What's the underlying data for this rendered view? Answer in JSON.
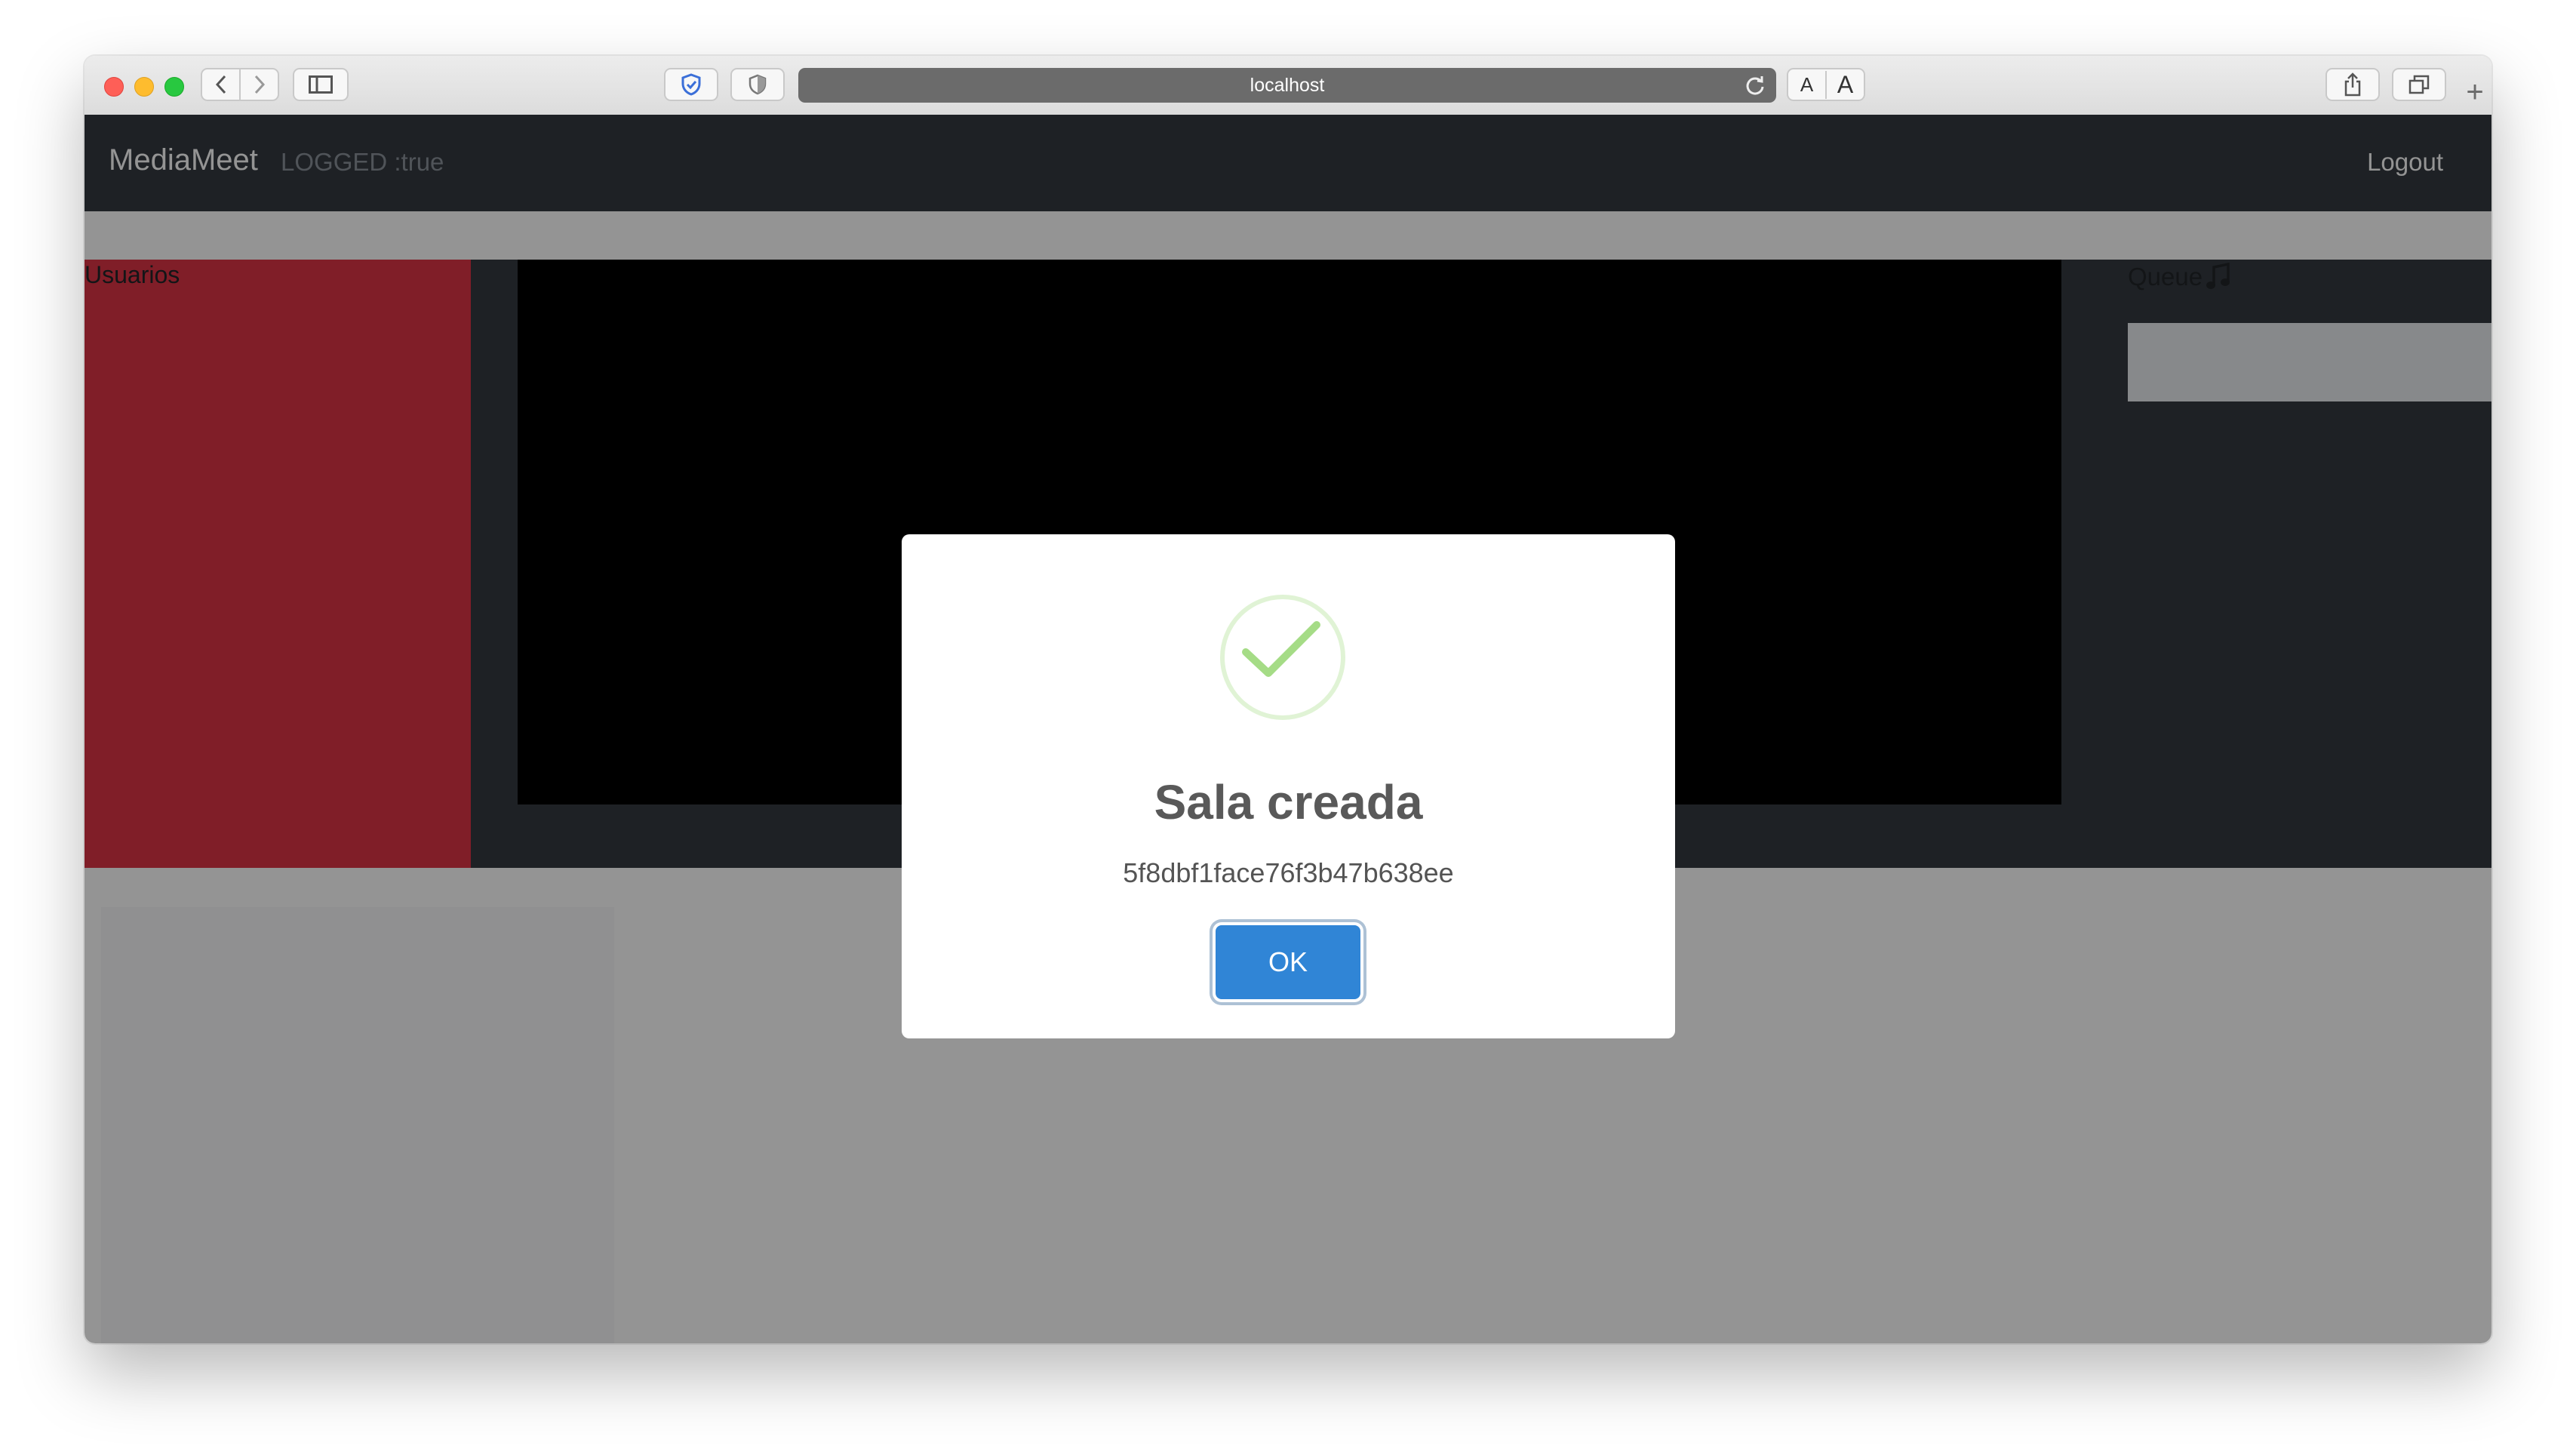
{
  "browser": {
    "url": "localhost",
    "text_size_small": "A",
    "text_size_large": "A",
    "new_tab": "+"
  },
  "navbar": {
    "brand": "MediaMeet",
    "status": "LOGGED :true",
    "logout": "Logout"
  },
  "users_panel": {
    "title": "Usuarios"
  },
  "queue": {
    "title": "Queue",
    "icon": "music-note-icon"
  },
  "modal": {
    "icon": "success-check-icon",
    "title": "Sala creada",
    "text": "5f8dbf1face76f3b47b638ee",
    "confirm_label": "OK"
  },
  "colors": {
    "navbar_bg": "#343a40",
    "users_panel_bg": "#dc3545",
    "confirm_button": "#3085d6",
    "success_green": "#a5dc86"
  }
}
